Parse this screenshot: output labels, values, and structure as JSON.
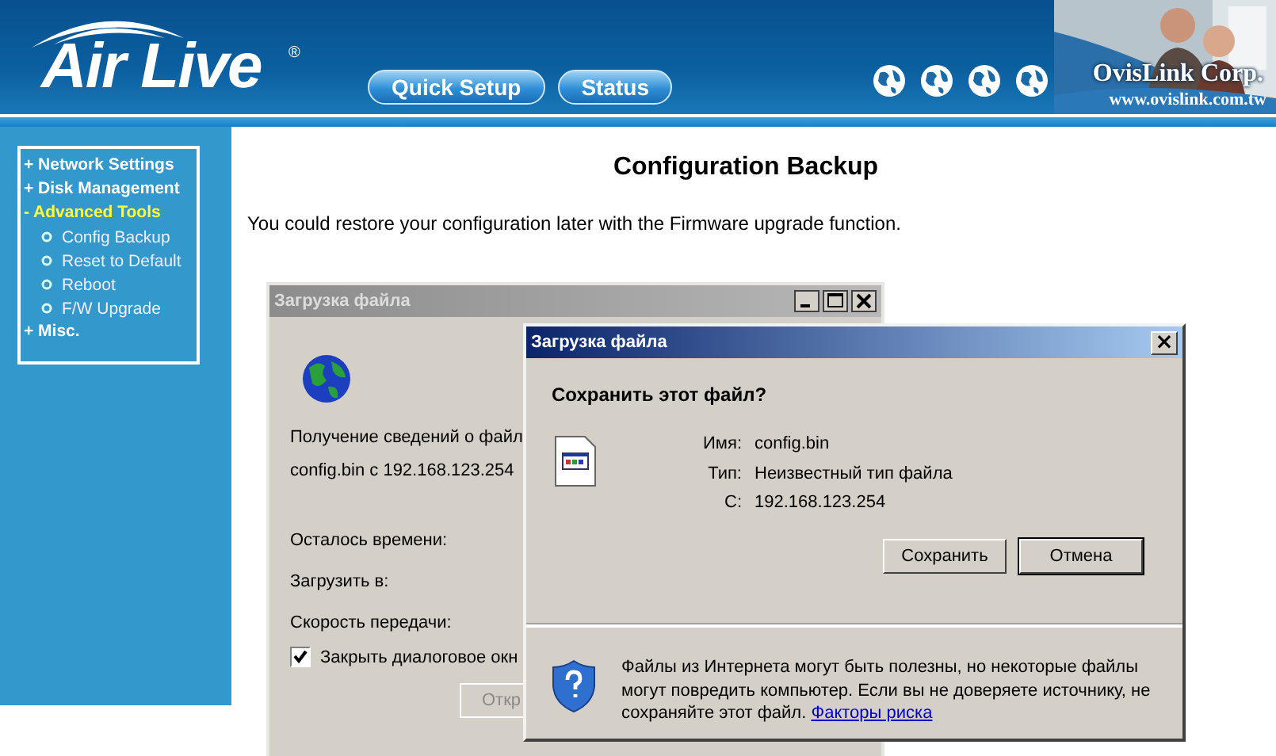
{
  "header": {
    "logo": "Air Live",
    "logo_mark": "®",
    "nav": [
      {
        "label": "Quick Setup"
      },
      {
        "label": "Status"
      }
    ],
    "company": "OvisLink Corp.",
    "website": "www.ovislink.com.tw"
  },
  "sidebar": {
    "items": [
      {
        "label": "+ Network Settings",
        "selected": false
      },
      {
        "label": "+ Disk Management",
        "selected": false
      },
      {
        "label": "- Advanced Tools",
        "selected": true,
        "children": [
          {
            "label": "Config Backup"
          },
          {
            "label": "Reset to Default"
          },
          {
            "label": "Reboot"
          },
          {
            "label": "F/W Upgrade"
          }
        ]
      },
      {
        "label": "+ Misc.",
        "selected": false
      }
    ]
  },
  "main": {
    "title": "Configuration Backup",
    "description": "You could restore your configuration later with the Firmware upgrade function."
  },
  "progress_dialog": {
    "title": "Загрузка файла",
    "lines": [
      "Получение сведений о файл",
      "config.bin с 192.168.123.254"
    ],
    "fields": [
      "Осталось времени:",
      "Загрузить в:",
      "Скорость передачи:"
    ],
    "checkbox": {
      "label": "Закрыть диалоговое окн",
      "checked": true
    },
    "button": "Откр"
  },
  "save_dialog": {
    "title": "Загрузка файла",
    "close": "×",
    "question": "Сохранить этот файл?",
    "rows": [
      {
        "label": "Имя:",
        "value": "config.bin"
      },
      {
        "label": "Тип:",
        "value": "Неизвестный тип файла"
      },
      {
        "label": "С:",
        "value": "192.168.123.254"
      }
    ],
    "buttons": [
      "Сохранить",
      "Отмена"
    ],
    "warning": "Файлы из Интернета могут быть полезны, но некоторые файлы могут повредить компьютер. Если вы не доверяете источнику, не сохраняйте этот файл.",
    "link": "Факторы риска"
  }
}
